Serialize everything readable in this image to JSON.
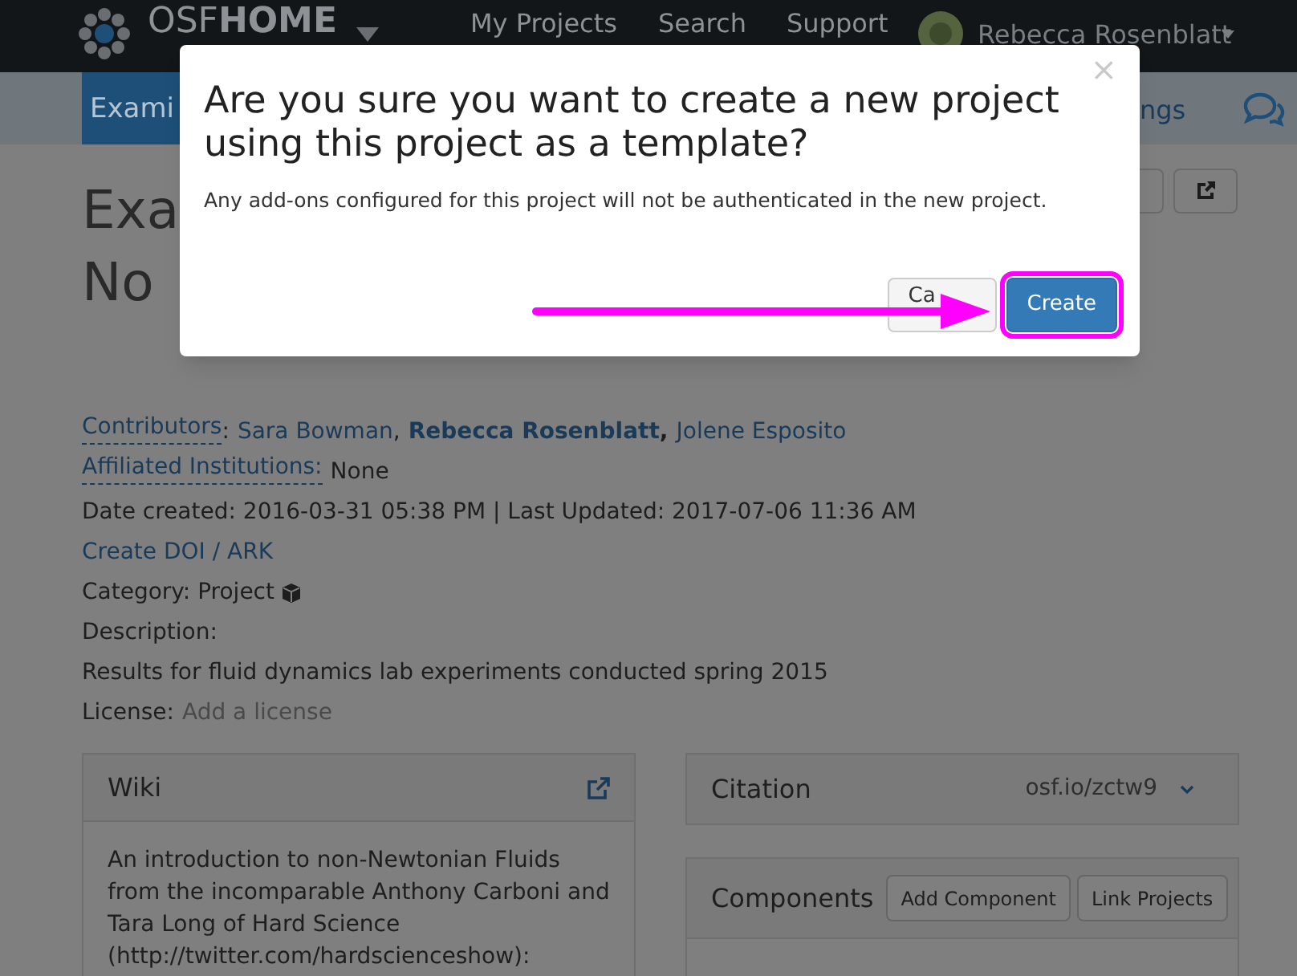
{
  "navbar": {
    "brand_light": "OSF",
    "brand_bold": "HOME",
    "links": [
      "My Projects",
      "Search",
      "Support"
    ],
    "user": "Rebecca Rosenblatt"
  },
  "project_nav": {
    "tab": "Exami",
    "right_link": "ngs"
  },
  "title_lines": [
    "Exa",
    "No"
  ],
  "meta": {
    "contributors_label": "Contributors",
    "contributors_colon": ":",
    "contributors": [
      {
        "name": "Sara Bowman",
        "suffix": ",",
        "bold": false
      },
      {
        "name": "Rebecca Rosenblatt",
        "suffix": ",",
        "bold": true
      },
      {
        "name": "Jolene Esposito",
        "bold": false
      }
    ],
    "institutions_label": "Affiliated Institutions:",
    "institutions": "None",
    "dates": "Date created: 2016-03-31 05:38 PM | Last Updated: 2017-07-06 11:36 AM",
    "doi_link": "Create DOI / ARK",
    "category_label": "Category: Project",
    "description_label": "Description:",
    "description": "Results for fluid dynamics lab experiments conducted spring 2015",
    "license_label": "License:",
    "license_link": "Add a license"
  },
  "wiki": {
    "title": "Wiki",
    "text": "An introduction to non-Newtonian Fluids from the incomparable Anthony Carboni and Tara Long of Hard Science (http://twitter.com/hardscienceshow):"
  },
  "citation": {
    "title": "Citation",
    "url": "osf.io/zctw9"
  },
  "components": {
    "title": "Components",
    "buttons": [
      "Add Component",
      "Link Projects"
    ]
  },
  "modal": {
    "title": "Are you sure you want to create a new project using this project as a template?",
    "body": "Any add-ons configured for this project will not be authenticated in the new project.",
    "close": "×",
    "buttons": [
      {
        "label": "Ca",
        "kind": "default",
        "highlighted": false
      },
      {
        "label": "Create",
        "kind": "primary",
        "highlighted": true
      }
    ]
  }
}
